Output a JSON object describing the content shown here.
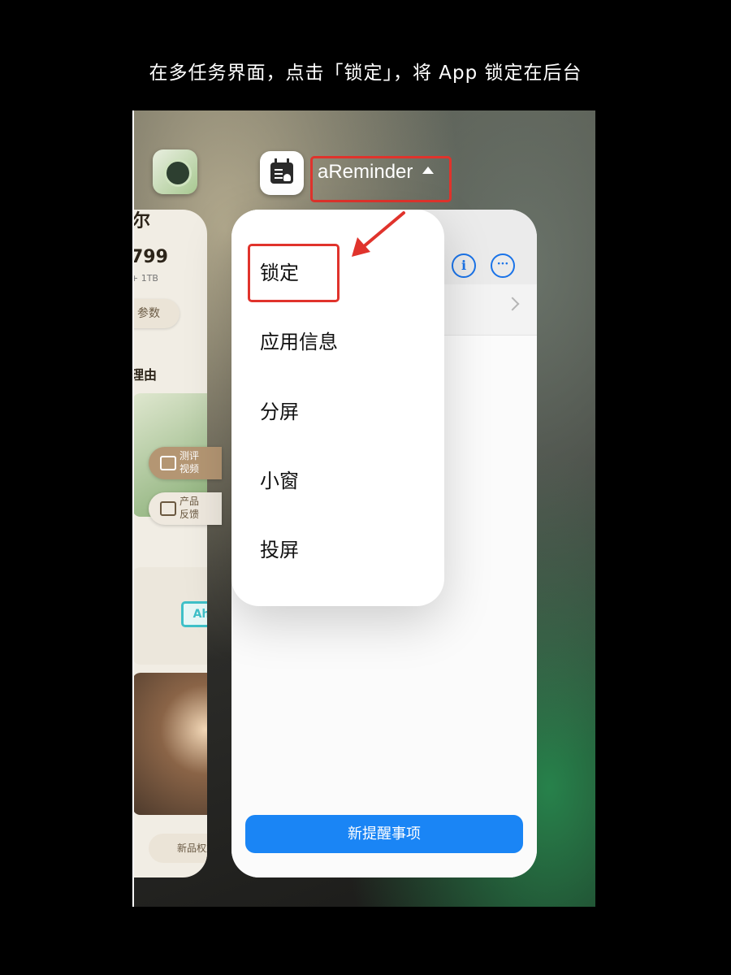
{
  "caption": "在多任务界面，点击「锁定」，将 App 锁定在后台",
  "left_app": {
    "partial_title": "尔",
    "price": "799",
    "storage": "+ 1TB",
    "params_button": "参数",
    "reason_heading": "理由",
    "review_video_button": "测评视频",
    "feedback_button": "产品反馈",
    "battery_unit": "Ah",
    "benefits_button": "新品权益"
  },
  "main_app": {
    "name": "aReminder",
    "info_icon": "info-icon",
    "more_icon": "more-icon",
    "new_reminder_button": "新提醒事项",
    "accent": "#1a85f5"
  },
  "menu": {
    "items": [
      "锁定",
      "应用信息",
      "分屏",
      "小窗",
      "投屏"
    ]
  },
  "annotation_color": "#e0332c"
}
